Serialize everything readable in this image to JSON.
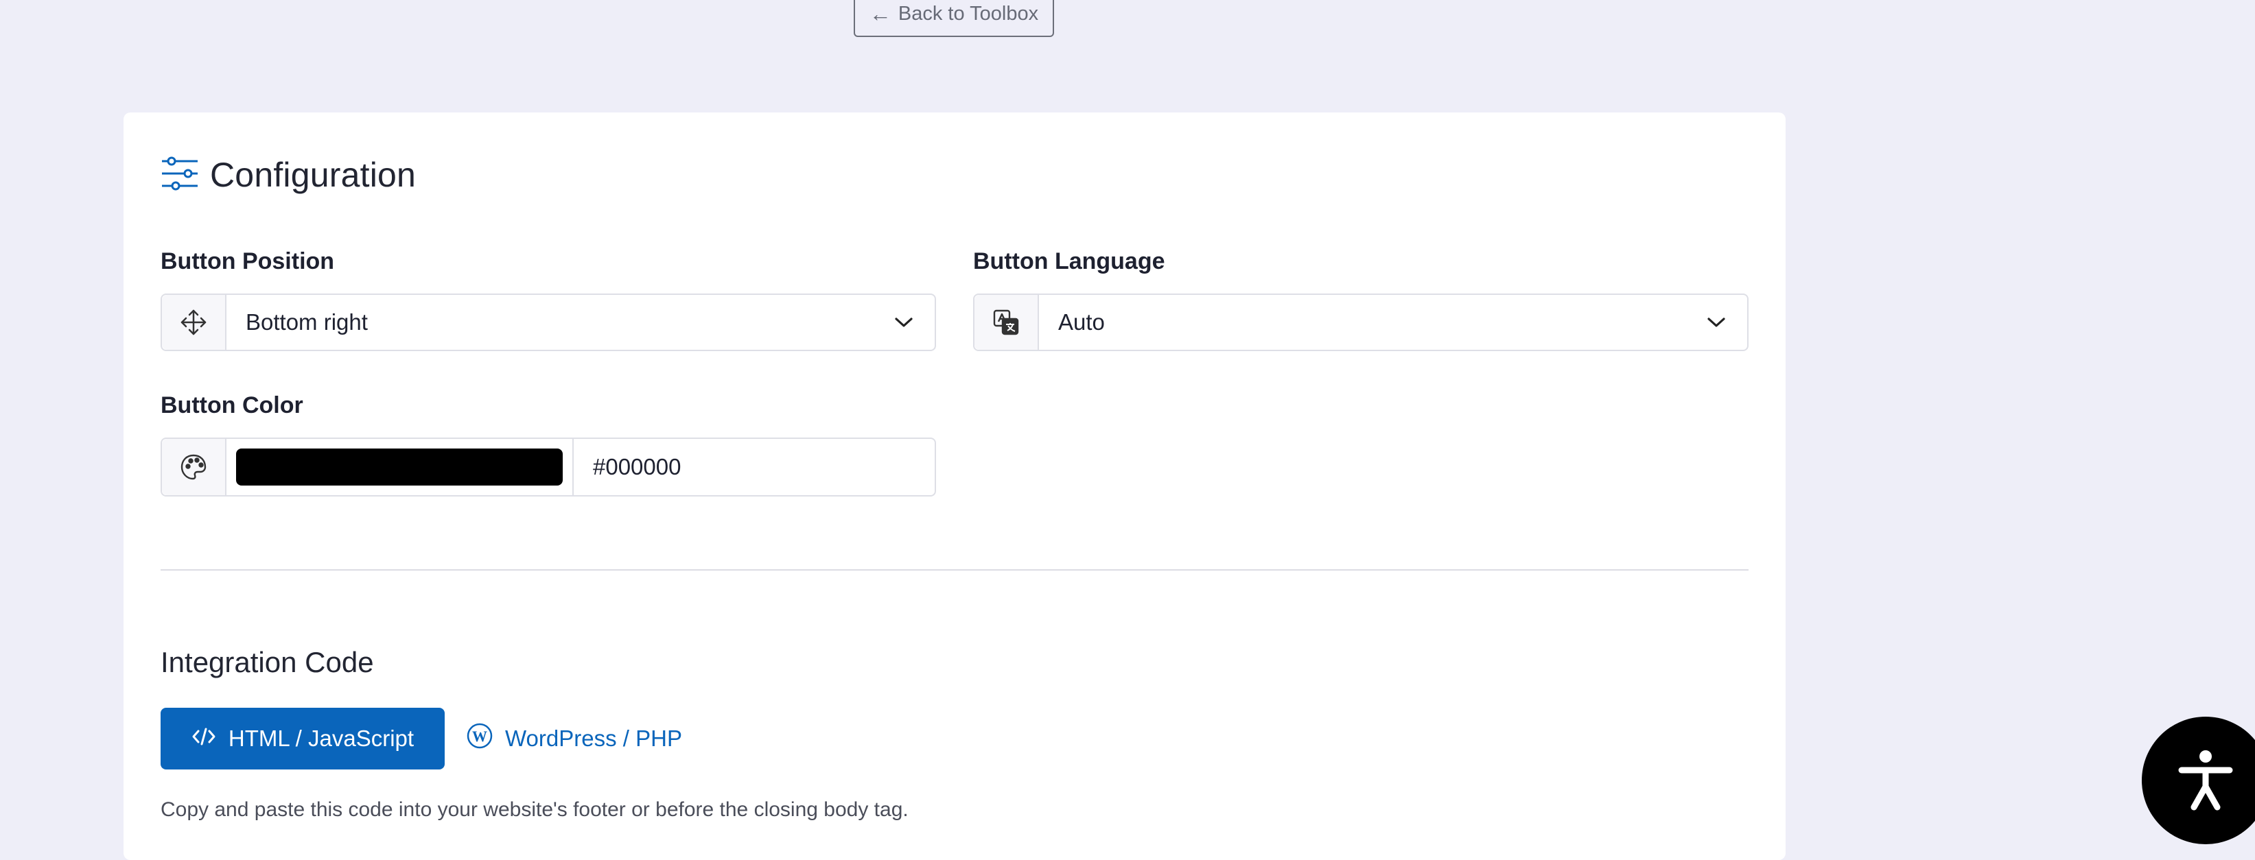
{
  "top": {
    "back_label": "Back to Toolbox"
  },
  "configuration": {
    "title": "Configuration",
    "position": {
      "label": "Button Position",
      "value": "Bottom right"
    },
    "language": {
      "label": "Button Language",
      "value": "Auto"
    },
    "color": {
      "label": "Button Color",
      "hex": "#000000"
    }
  },
  "integration": {
    "title": "Integration Code",
    "tabs": [
      {
        "label": "HTML / JavaScript",
        "active": true
      },
      {
        "label": "WordPress / PHP",
        "active": false
      }
    ],
    "hint": "Copy and paste this code into your website's footer or before the closing body tag."
  },
  "colors": {
    "accent": "#0a65bb",
    "background": "#eeeef8",
    "swatch": "#000000"
  }
}
